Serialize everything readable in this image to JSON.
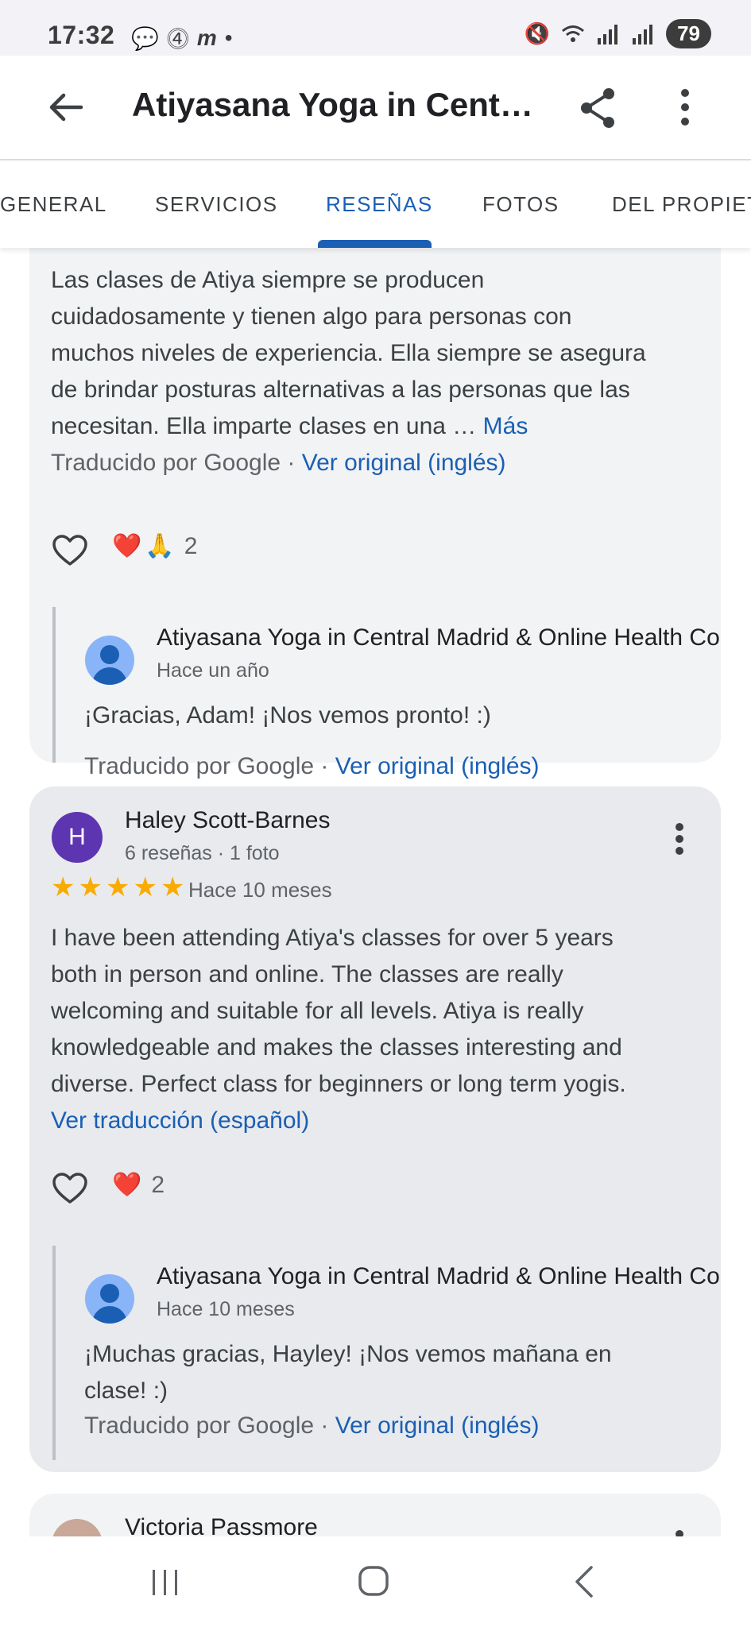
{
  "status_bar": {
    "time": "17:32",
    "battery": "79"
  },
  "app_bar": {
    "title": "Atiyasana Yoga in Cent…"
  },
  "tabs": [
    "GENERAL",
    "SERVICIOS",
    "RESEÑAS",
    "FOTOS",
    "DEL PROPIET."
  ],
  "active_tab": "RESEÑAS",
  "review1": {
    "text_lines": [
      "Las clases de Atiya siempre se producen",
      "cuidadosamente y tienen algo para personas con",
      "muchos niveles de experiencia. Ella siempre se asegura",
      "de brindar posturas alternativas a las personas que las",
      "necesitan. Ella imparte clases en una …"
    ],
    "more_label": "Más",
    "translated_by": "Traducido por Google ·",
    "view_original": "Ver original (inglés)",
    "reaction_count": "2",
    "reply": {
      "owner": "Atiyasana Yoga in Central Madrid & Online Health Co",
      "time": "Hace un año",
      "text": "¡Gracias, Adam! ¡Nos vemos pronto! :)",
      "translated_by": "Traducido por Google ·",
      "view_original": "Ver original (inglés)"
    }
  },
  "review2": {
    "avatar_letter": "H",
    "author": "Haley Scott-Barnes",
    "meta": "6 reseñas · 1 foto",
    "rating": 5,
    "time": "Hace 10 meses",
    "text_lines": [
      "I have been attending Atiya's classes for over 5 years",
      "both in person and online. The classes are really",
      "welcoming and suitable for all levels. Atiya is really",
      "knowledgeable and makes the classes interesting and",
      "diverse. Perfect class for beginners or long term yogis."
    ],
    "translate_link": "Ver traducción (español)",
    "reaction_count": "2",
    "reply": {
      "owner": "Atiyasana Yoga in Central Madrid & Online Health Co",
      "time": "Hace 10 meses",
      "text_lines": [
        "¡Muchas gracias, Hayley! ¡Nos vemos mañana en",
        "clase! :)"
      ],
      "translated_by": "Traducido por Google ·",
      "view_original": "Ver original (inglés)"
    }
  },
  "review3": {
    "author": "Victoria Passmore"
  },
  "colors": {
    "accent": "#1a5fb4",
    "star": "#f9ab00",
    "card_bg": "#f1f3f4",
    "selected_card_bg": "#e8eaed",
    "avatar_purple": "#5e35b1"
  }
}
